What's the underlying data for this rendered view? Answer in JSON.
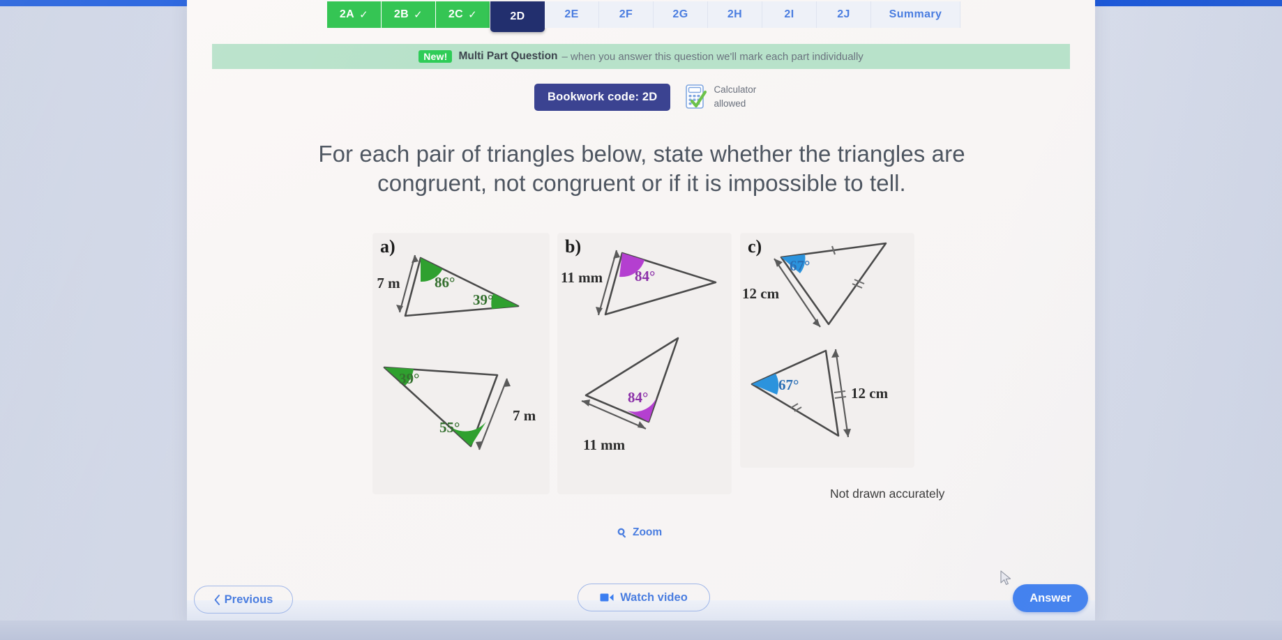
{
  "top_strip_color": "#2563e6",
  "tabs": [
    {
      "label": "2A",
      "state": "done",
      "check": "✓"
    },
    {
      "label": "2B",
      "state": "done",
      "check": "✓"
    },
    {
      "label": "2C",
      "state": "done",
      "check": "✓"
    },
    {
      "label": "2D",
      "state": "active",
      "check": ""
    },
    {
      "label": "2E",
      "state": "todo",
      "check": ""
    },
    {
      "label": "2F",
      "state": "todo",
      "check": ""
    },
    {
      "label": "2G",
      "state": "todo",
      "check": ""
    },
    {
      "label": "2H",
      "state": "todo",
      "check": ""
    },
    {
      "label": "2I",
      "state": "todo",
      "check": ""
    },
    {
      "label": "2J",
      "state": "todo",
      "check": ""
    },
    {
      "label": "Summary",
      "state": "todo",
      "check": ""
    }
  ],
  "banner": {
    "new_label": "New!",
    "title": "Multi Part Question",
    "description": "– when you answer this question we'll mark each part individually",
    "background_color": "#b8e2ca",
    "pill_color": "#2ecc57"
  },
  "bookwork": {
    "code_label": "Bookwork code: 2D",
    "badge_color": "#3b4391",
    "calculator_line1": "Calculator",
    "calculator_line2": "allowed",
    "calculator_icon": "calculator-allowed-icon"
  },
  "question": {
    "line1": "For each pair of triangles below, state whether the triangles are",
    "line2": "congruent, not congruent or if it is impossible to tell."
  },
  "diagrams": {
    "note": "Not drawn accurately",
    "panels": [
      {
        "id": "a",
        "label": "a)",
        "angle_color": "#2fa02f",
        "triangles": [
          {
            "position": "top",
            "angles": [
              "86°",
              "39°"
            ],
            "sides": [
              "7 m"
            ]
          },
          {
            "position": "bottom",
            "angles": [
              "39°",
              "55°"
            ],
            "sides": [
              "7 m"
            ]
          }
        ]
      },
      {
        "id": "b",
        "label": "b)",
        "angle_color": "#b43fd0",
        "triangles": [
          {
            "position": "top",
            "angles": [
              "84°"
            ],
            "sides": [
              "11 mm"
            ]
          },
          {
            "position": "bottom",
            "angles": [
              "84°"
            ],
            "sides": [
              "11 mm"
            ]
          }
        ]
      },
      {
        "id": "c",
        "label": "c)",
        "angle_color": "#2b93dd",
        "triangles": [
          {
            "position": "top",
            "angles": [
              "67°"
            ],
            "sides": [
              "12 cm"
            ]
          },
          {
            "position": "bottom",
            "angles": [
              "67°"
            ],
            "sides": [
              "12 cm"
            ]
          }
        ]
      }
    ],
    "labels": {
      "a_top_86": "86°",
      "a_top_39": "39°",
      "a_top_7m": "7 m",
      "a_bot_39": "39°",
      "a_bot_55": "55°",
      "a_bot_7m": "7 m",
      "b_top_84": "84°",
      "b_top_11mm": "11 mm",
      "b_bot_84": "84°",
      "b_bot_11mm": "11 mm",
      "c_top_67": "67°",
      "c_top_12cm": "12 cm",
      "c_bot_67": "67°",
      "c_bot_12cm": "12 cm"
    }
  },
  "zoom_control": {
    "label": "Zoom",
    "icon": "magnifier-icon"
  },
  "footer": {
    "previous_label": "Previous",
    "previous_icon": "chevron-left-icon",
    "watch_label": "Watch video",
    "watch_icon": "video-camera-icon",
    "answer_label": "Answer",
    "answer_color": "#3b7df0"
  }
}
